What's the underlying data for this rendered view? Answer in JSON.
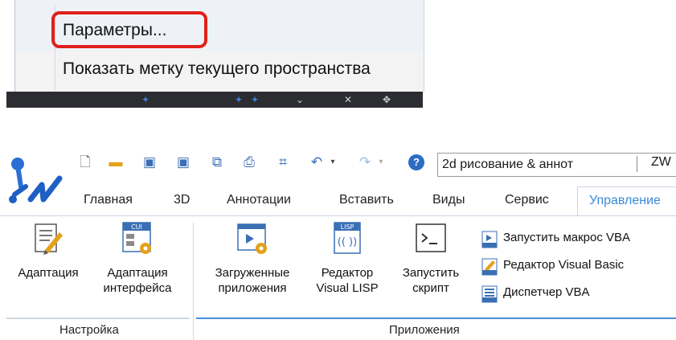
{
  "context_menu": {
    "items": [
      {
        "label": "Параметры..."
      },
      {
        "label": "Показать метку текущего пространства"
      }
    ]
  },
  "app": {
    "workspace_select": "2d рисование & аннот",
    "qat_overflow": "ZW",
    "tabs": [
      "Главная",
      "3D",
      "Аннотации",
      "Вставить",
      "Виды",
      "Сервис",
      "Управление"
    ],
    "active_tab": "Управление",
    "groups": [
      {
        "label": "Настройка",
        "buttons": [
          {
            "label": "Адаптация"
          },
          {
            "label_line1": "Адаптация",
            "label_line2": "интерфейса",
            "icon_text": "CUI"
          }
        ]
      },
      {
        "label": "Приложения",
        "buttons": [
          {
            "label_line1": "Загруженные",
            "label_line2": "приложения"
          },
          {
            "label_line1": "Редактор",
            "label_line2": "Visual LISP",
            "icon_text": "LISP"
          },
          {
            "label_line1": "Запустить",
            "label_line2": "скрипт"
          }
        ],
        "small_buttons": [
          {
            "label": "Запустить макрос VBA"
          },
          {
            "label": "Редактор Visual Basic"
          },
          {
            "label": "Диспетчер VBA"
          }
        ]
      }
    ],
    "colors": {
      "accent": "#3b8ad8",
      "highlight": "#e0201c",
      "group_bar": "#4a90d9"
    }
  }
}
